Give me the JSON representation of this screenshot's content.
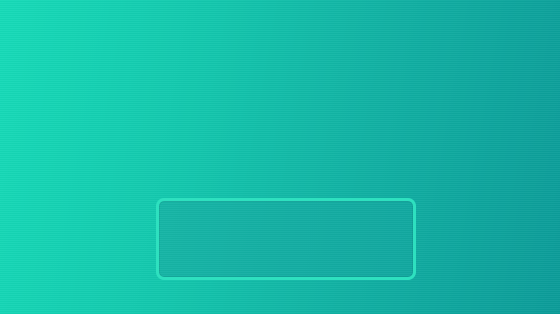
{
  "screen": {
    "background_colors": [
      "#16dbb8",
      "#13c7ad",
      "#11b0a3",
      "#0c9c99"
    ]
  },
  "panel": {
    "text": "",
    "border_color": "#2ee0bf",
    "fill_color": "#14aea3"
  }
}
